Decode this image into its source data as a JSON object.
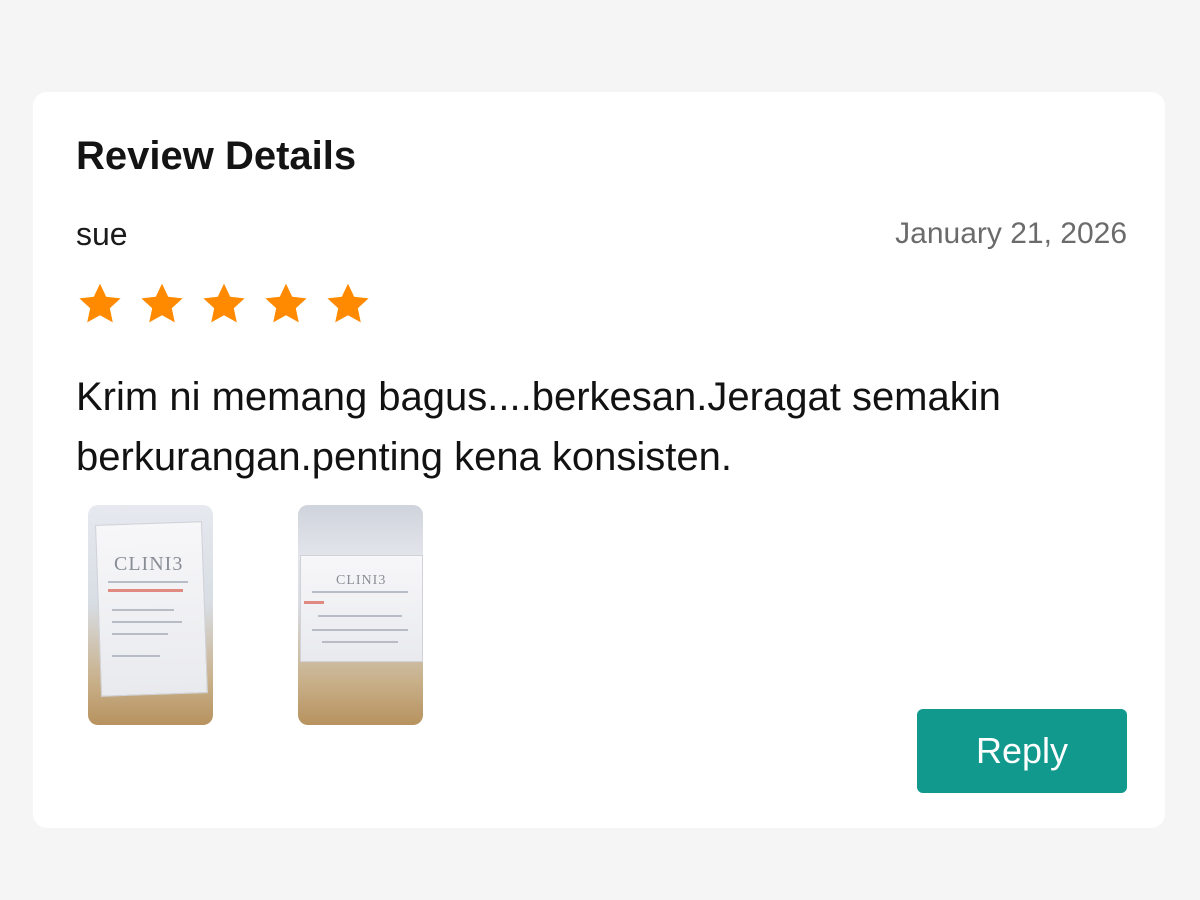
{
  "review": {
    "heading": "Review Details",
    "reviewer": "sue",
    "date": "January 21, 2026",
    "rating": 5,
    "rating_max": 5,
    "text": "Krim ni memang bagus....berkesan.Jeragat semakin berkurangan.penting kena konsisten.",
    "photos": [
      {
        "brand": "CLINI3"
      },
      {
        "brand": "CLINI3"
      }
    ]
  },
  "actions": {
    "reply_label": "Reply"
  },
  "colors": {
    "star": "#ff8a00",
    "accent": "#11998e"
  }
}
